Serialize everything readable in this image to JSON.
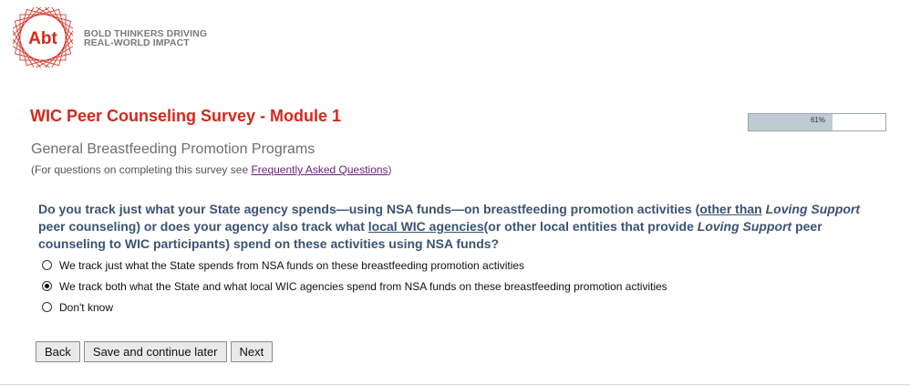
{
  "brand": {
    "logo_text": "Abt",
    "tagline_line1": "BOLD THINKERS DRIVING",
    "tagline_line2": "REAL-WORLD IMPACT"
  },
  "colors": {
    "brand_red": "#d5281c",
    "question_blue": "#3a5373",
    "progress_fill": "#bfcbd2",
    "link_purple": "#6a1a7a"
  },
  "header": {
    "title": "WIC Peer Counseling Survey - Module 1"
  },
  "progress": {
    "label": "61%",
    "value": 0.61
  },
  "section": {
    "title": "General Breastfeeding Promotion Programs",
    "note_prefix": "(For questions on completing this survey see ",
    "note_link": "Frequently Asked Questions",
    "note_suffix": ")"
  },
  "question": {
    "part1": "Do you track just what your State agency spends—using NSA funds—on breastfeeding promotion activities (",
    "part2": "other than",
    "part3": " ",
    "part4": "Loving Support",
    "part5": " peer counseling) or does your agency also track what ",
    "part6": "local WIC agencies",
    "part7": "(or other local entities that provide ",
    "part8": "Loving Support",
    "part9": " peer counseling to WIC participants) spend on these activities using NSA funds?"
  },
  "options": [
    {
      "label": "We track just what the State spends from NSA funds on these breastfeeding promotion activities",
      "selected": false
    },
    {
      "label": "We track both what the State and what local WIC agencies spend from NSA funds on these breastfeeding promotion activities",
      "selected": true
    },
    {
      "label": "Don't know",
      "selected": false
    }
  ],
  "buttons": {
    "back": "Back",
    "save": "Save and continue later",
    "next": "Next"
  }
}
